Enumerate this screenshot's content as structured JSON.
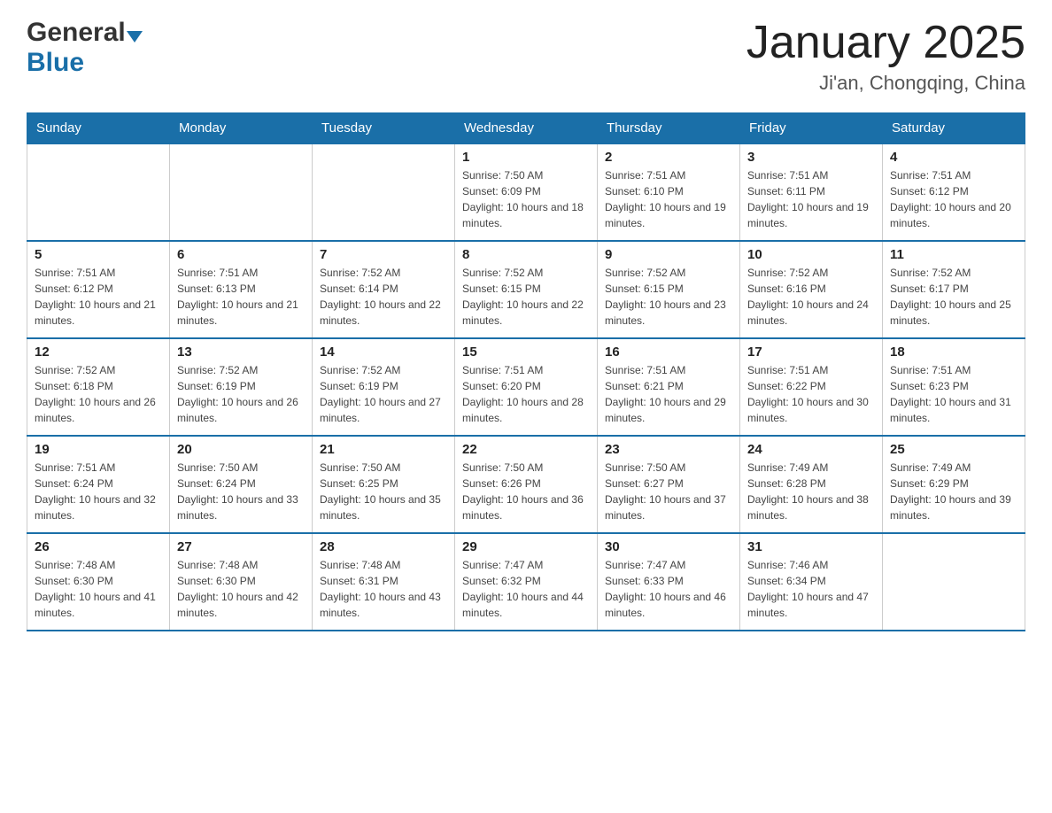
{
  "header": {
    "logo_general": "General",
    "logo_blue": "Blue",
    "month_title": "January 2025",
    "location": "Ji'an, Chongqing, China"
  },
  "days_of_week": [
    "Sunday",
    "Monday",
    "Tuesday",
    "Wednesday",
    "Thursday",
    "Friday",
    "Saturday"
  ],
  "weeks": [
    [
      {
        "num": "",
        "sunrise": "",
        "sunset": "",
        "daylight": ""
      },
      {
        "num": "",
        "sunrise": "",
        "sunset": "",
        "daylight": ""
      },
      {
        "num": "",
        "sunrise": "",
        "sunset": "",
        "daylight": ""
      },
      {
        "num": "1",
        "sunrise": "Sunrise: 7:50 AM",
        "sunset": "Sunset: 6:09 PM",
        "daylight": "Daylight: 10 hours and 18 minutes."
      },
      {
        "num": "2",
        "sunrise": "Sunrise: 7:51 AM",
        "sunset": "Sunset: 6:10 PM",
        "daylight": "Daylight: 10 hours and 19 minutes."
      },
      {
        "num": "3",
        "sunrise": "Sunrise: 7:51 AM",
        "sunset": "Sunset: 6:11 PM",
        "daylight": "Daylight: 10 hours and 19 minutes."
      },
      {
        "num": "4",
        "sunrise": "Sunrise: 7:51 AM",
        "sunset": "Sunset: 6:12 PM",
        "daylight": "Daylight: 10 hours and 20 minutes."
      }
    ],
    [
      {
        "num": "5",
        "sunrise": "Sunrise: 7:51 AM",
        "sunset": "Sunset: 6:12 PM",
        "daylight": "Daylight: 10 hours and 21 minutes."
      },
      {
        "num": "6",
        "sunrise": "Sunrise: 7:51 AM",
        "sunset": "Sunset: 6:13 PM",
        "daylight": "Daylight: 10 hours and 21 minutes."
      },
      {
        "num": "7",
        "sunrise": "Sunrise: 7:52 AM",
        "sunset": "Sunset: 6:14 PM",
        "daylight": "Daylight: 10 hours and 22 minutes."
      },
      {
        "num": "8",
        "sunrise": "Sunrise: 7:52 AM",
        "sunset": "Sunset: 6:15 PM",
        "daylight": "Daylight: 10 hours and 22 minutes."
      },
      {
        "num": "9",
        "sunrise": "Sunrise: 7:52 AM",
        "sunset": "Sunset: 6:15 PM",
        "daylight": "Daylight: 10 hours and 23 minutes."
      },
      {
        "num": "10",
        "sunrise": "Sunrise: 7:52 AM",
        "sunset": "Sunset: 6:16 PM",
        "daylight": "Daylight: 10 hours and 24 minutes."
      },
      {
        "num": "11",
        "sunrise": "Sunrise: 7:52 AM",
        "sunset": "Sunset: 6:17 PM",
        "daylight": "Daylight: 10 hours and 25 minutes."
      }
    ],
    [
      {
        "num": "12",
        "sunrise": "Sunrise: 7:52 AM",
        "sunset": "Sunset: 6:18 PM",
        "daylight": "Daylight: 10 hours and 26 minutes."
      },
      {
        "num": "13",
        "sunrise": "Sunrise: 7:52 AM",
        "sunset": "Sunset: 6:19 PM",
        "daylight": "Daylight: 10 hours and 26 minutes."
      },
      {
        "num": "14",
        "sunrise": "Sunrise: 7:52 AM",
        "sunset": "Sunset: 6:19 PM",
        "daylight": "Daylight: 10 hours and 27 minutes."
      },
      {
        "num": "15",
        "sunrise": "Sunrise: 7:51 AM",
        "sunset": "Sunset: 6:20 PM",
        "daylight": "Daylight: 10 hours and 28 minutes."
      },
      {
        "num": "16",
        "sunrise": "Sunrise: 7:51 AM",
        "sunset": "Sunset: 6:21 PM",
        "daylight": "Daylight: 10 hours and 29 minutes."
      },
      {
        "num": "17",
        "sunrise": "Sunrise: 7:51 AM",
        "sunset": "Sunset: 6:22 PM",
        "daylight": "Daylight: 10 hours and 30 minutes."
      },
      {
        "num": "18",
        "sunrise": "Sunrise: 7:51 AM",
        "sunset": "Sunset: 6:23 PM",
        "daylight": "Daylight: 10 hours and 31 minutes."
      }
    ],
    [
      {
        "num": "19",
        "sunrise": "Sunrise: 7:51 AM",
        "sunset": "Sunset: 6:24 PM",
        "daylight": "Daylight: 10 hours and 32 minutes."
      },
      {
        "num": "20",
        "sunrise": "Sunrise: 7:50 AM",
        "sunset": "Sunset: 6:24 PM",
        "daylight": "Daylight: 10 hours and 33 minutes."
      },
      {
        "num": "21",
        "sunrise": "Sunrise: 7:50 AM",
        "sunset": "Sunset: 6:25 PM",
        "daylight": "Daylight: 10 hours and 35 minutes."
      },
      {
        "num": "22",
        "sunrise": "Sunrise: 7:50 AM",
        "sunset": "Sunset: 6:26 PM",
        "daylight": "Daylight: 10 hours and 36 minutes."
      },
      {
        "num": "23",
        "sunrise": "Sunrise: 7:50 AM",
        "sunset": "Sunset: 6:27 PM",
        "daylight": "Daylight: 10 hours and 37 minutes."
      },
      {
        "num": "24",
        "sunrise": "Sunrise: 7:49 AM",
        "sunset": "Sunset: 6:28 PM",
        "daylight": "Daylight: 10 hours and 38 minutes."
      },
      {
        "num": "25",
        "sunrise": "Sunrise: 7:49 AM",
        "sunset": "Sunset: 6:29 PM",
        "daylight": "Daylight: 10 hours and 39 minutes."
      }
    ],
    [
      {
        "num": "26",
        "sunrise": "Sunrise: 7:48 AM",
        "sunset": "Sunset: 6:30 PM",
        "daylight": "Daylight: 10 hours and 41 minutes."
      },
      {
        "num": "27",
        "sunrise": "Sunrise: 7:48 AM",
        "sunset": "Sunset: 6:30 PM",
        "daylight": "Daylight: 10 hours and 42 minutes."
      },
      {
        "num": "28",
        "sunrise": "Sunrise: 7:48 AM",
        "sunset": "Sunset: 6:31 PM",
        "daylight": "Daylight: 10 hours and 43 minutes."
      },
      {
        "num": "29",
        "sunrise": "Sunrise: 7:47 AM",
        "sunset": "Sunset: 6:32 PM",
        "daylight": "Daylight: 10 hours and 44 minutes."
      },
      {
        "num": "30",
        "sunrise": "Sunrise: 7:47 AM",
        "sunset": "Sunset: 6:33 PM",
        "daylight": "Daylight: 10 hours and 46 minutes."
      },
      {
        "num": "31",
        "sunrise": "Sunrise: 7:46 AM",
        "sunset": "Sunset: 6:34 PM",
        "daylight": "Daylight: 10 hours and 47 minutes."
      },
      {
        "num": "",
        "sunrise": "",
        "sunset": "",
        "daylight": ""
      }
    ]
  ]
}
